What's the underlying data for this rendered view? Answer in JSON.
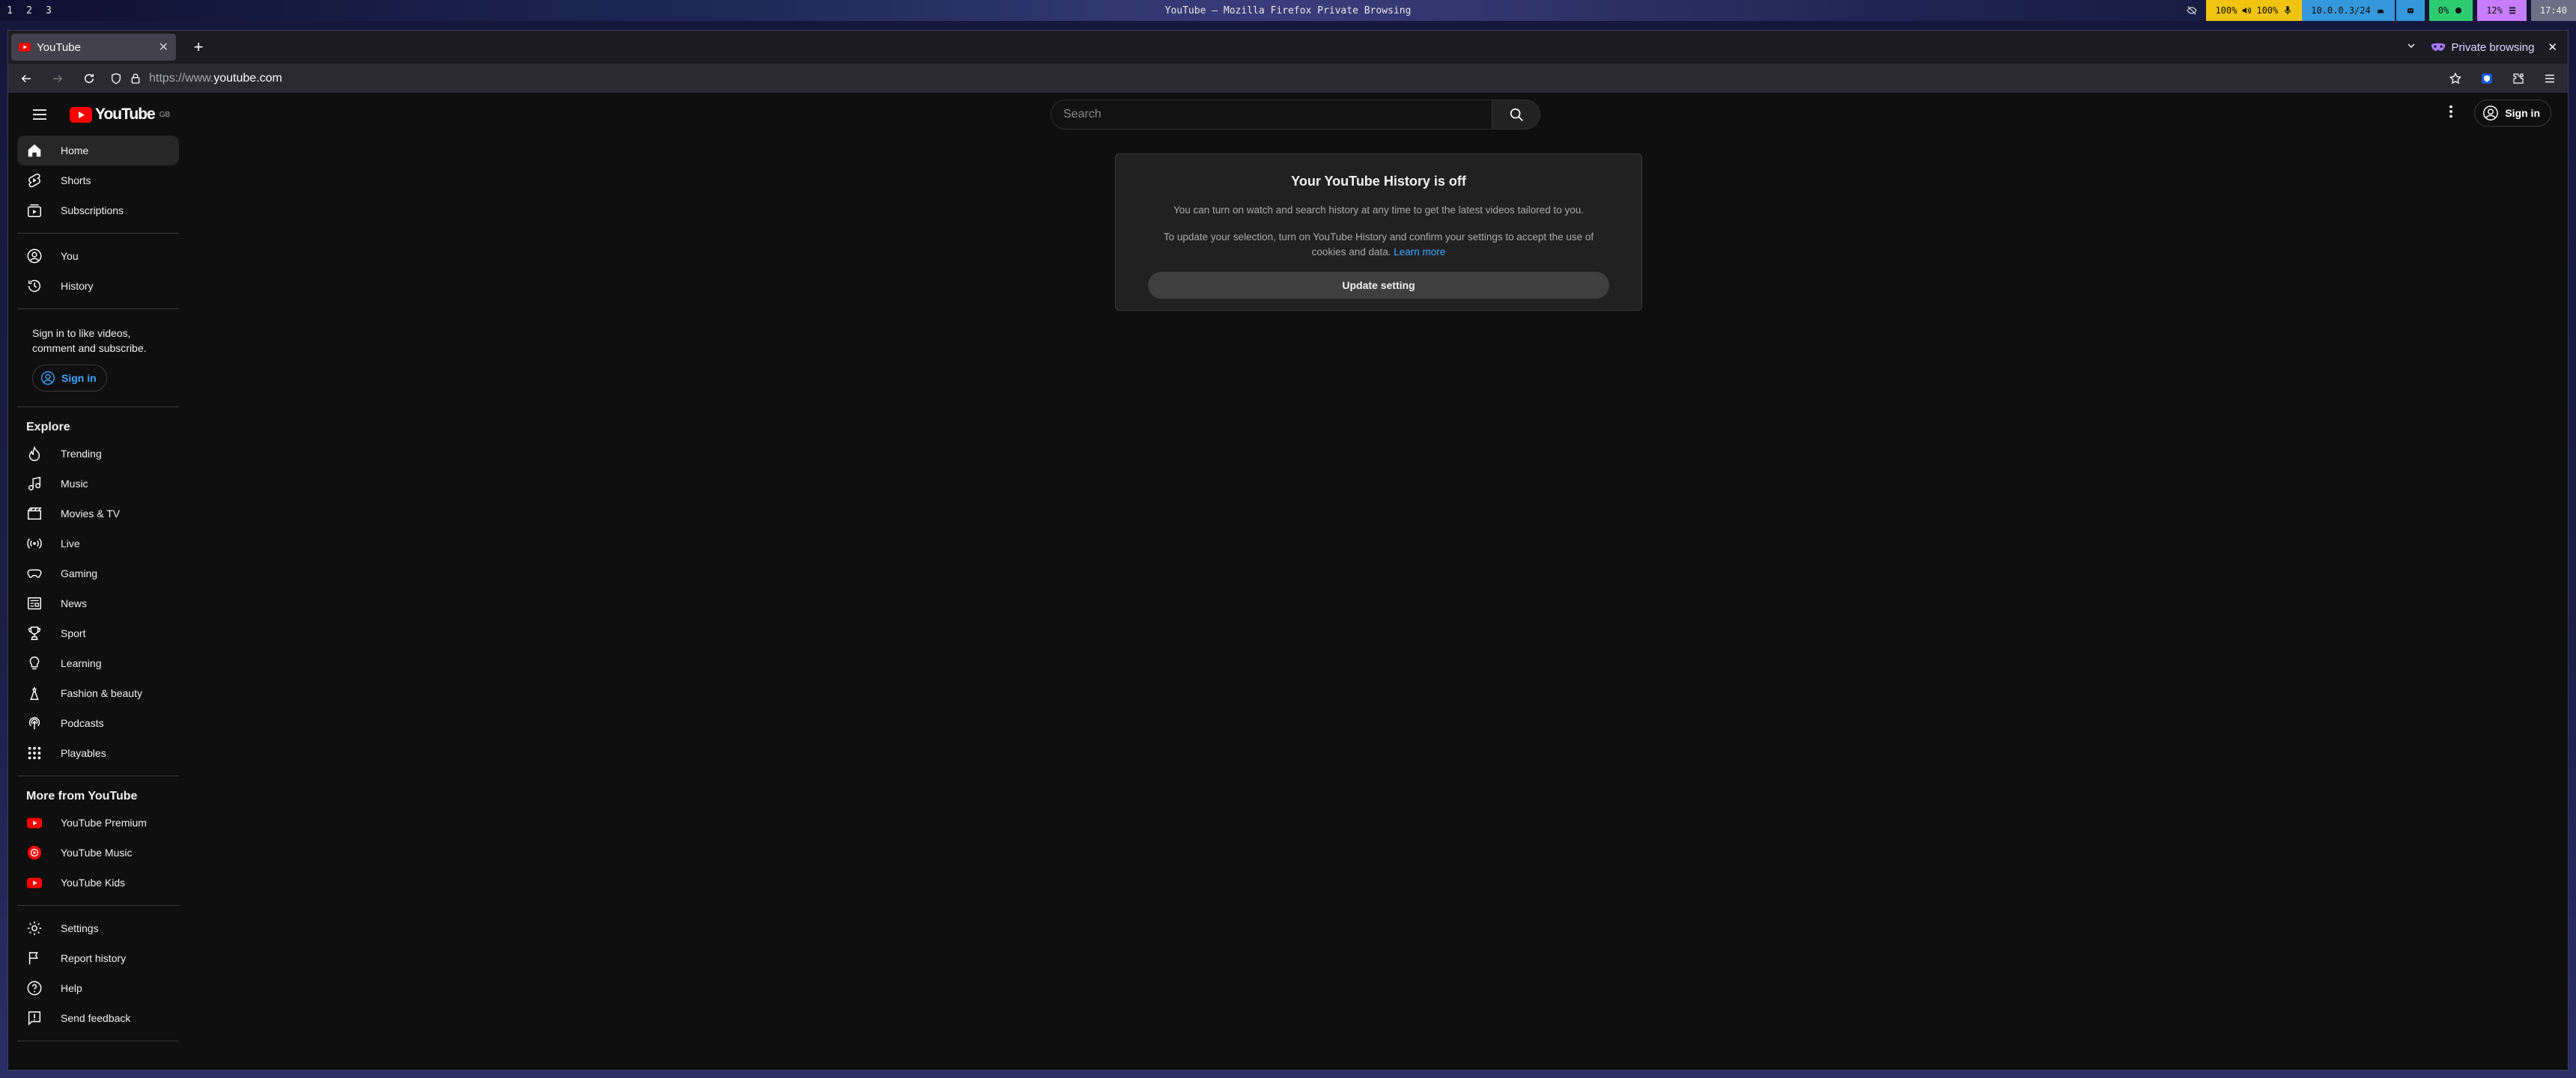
{
  "system_bar": {
    "workspaces": [
      "1",
      "2",
      "3"
    ],
    "title": "YouTube — Mozilla Firefox Private Browsing",
    "volume": "100%",
    "mic": "100%",
    "network": "10.0.0.3/24",
    "cpu": "0%",
    "memory": "12%",
    "clock": "17:40",
    "colors": {
      "audio": "#f1c40f",
      "network": "#3498db",
      "cpu": "#2ecc71",
      "memory": "#c77dff"
    }
  },
  "browser": {
    "tab_title": "YouTube",
    "private_label": "Private browsing",
    "url_scheme": "https://www.",
    "url_host": "youtube.com"
  },
  "youtube": {
    "logo_text": "YouTube",
    "country_code": "GB",
    "search_placeholder": "Search",
    "signin_label": "Sign in",
    "sidebar": {
      "main": [
        {
          "label": "Home",
          "icon": "home-icon"
        },
        {
          "label": "Shorts",
          "icon": "shorts-icon"
        },
        {
          "label": "Subscriptions",
          "icon": "subscriptions-icon"
        }
      ],
      "you": [
        {
          "label": "You",
          "icon": "you-icon"
        },
        {
          "label": "History",
          "icon": "history-icon"
        }
      ],
      "signin_prompt": "Sign in to like videos, comment and subscribe.",
      "signin_button": "Sign in",
      "explore_title": "Explore",
      "explore": [
        {
          "label": "Trending",
          "icon": "trending-icon"
        },
        {
          "label": "Music",
          "icon": "music-icon"
        },
        {
          "label": "Movies & TV",
          "icon": "movies-icon"
        },
        {
          "label": "Live",
          "icon": "live-icon"
        },
        {
          "label": "Gaming",
          "icon": "gaming-icon"
        },
        {
          "label": "News",
          "icon": "news-icon"
        },
        {
          "label": "Sport",
          "icon": "sport-icon"
        },
        {
          "label": "Learning",
          "icon": "learning-icon"
        },
        {
          "label": "Fashion & beauty",
          "icon": "fashion-icon"
        },
        {
          "label": "Podcasts",
          "icon": "podcasts-icon"
        },
        {
          "label": "Playables",
          "icon": "playables-icon"
        }
      ],
      "more_title": "More from YouTube",
      "more": [
        {
          "label": "YouTube Premium",
          "icon": "youtube-premium-icon"
        },
        {
          "label": "YouTube Music",
          "icon": "youtube-music-icon"
        },
        {
          "label": "YouTube Kids",
          "icon": "youtube-kids-icon"
        }
      ],
      "footer": [
        {
          "label": "Settings",
          "icon": "settings-icon"
        },
        {
          "label": "Report history",
          "icon": "report-flag-icon"
        },
        {
          "label": "Help",
          "icon": "help-icon"
        },
        {
          "label": "Send feedback",
          "icon": "feedback-icon"
        }
      ]
    },
    "dialog": {
      "title": "Your YouTube History is off",
      "line1": "You can turn on watch and search history at any time to get the latest videos tailored to you.",
      "line2": "To update your selection, turn on YouTube History and confirm your settings to accept the use of cookies and data.",
      "learn_more": "Learn more",
      "button": "Update setting"
    }
  }
}
